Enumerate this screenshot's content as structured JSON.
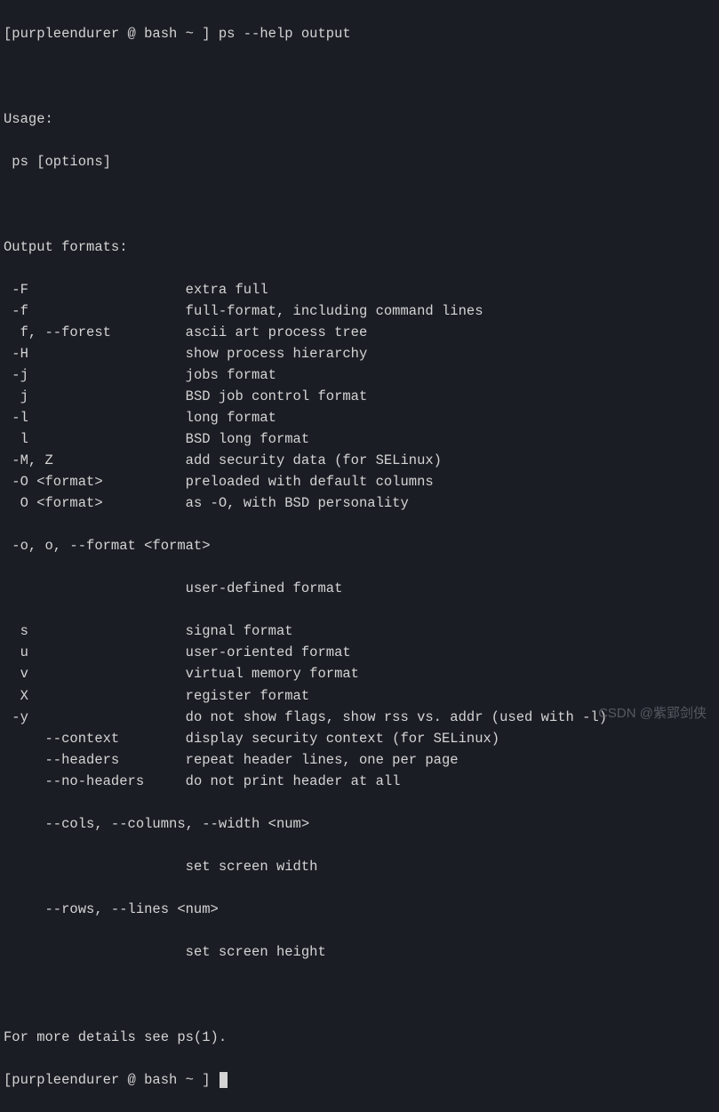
{
  "prompt1": {
    "user": "[purpleendurer @ bash ~ ] ",
    "command": "ps --help output"
  },
  "usage_header": "Usage:",
  "usage_line": " ps [options]",
  "section_header": "Output formats:",
  "options": [
    {
      "flag": " -F",
      "desc": "extra full"
    },
    {
      "flag": " -f",
      "desc": "full-format, including command lines"
    },
    {
      "flag": "  f, --forest",
      "desc": "ascii art process tree"
    },
    {
      "flag": " -H",
      "desc": "show process hierarchy"
    },
    {
      "flag": " -j",
      "desc": "jobs format"
    },
    {
      "flag": "  j",
      "desc": "BSD job control format"
    },
    {
      "flag": " -l",
      "desc": "long format"
    },
    {
      "flag": "  l",
      "desc": "BSD long format"
    },
    {
      "flag": " -M, Z",
      "desc": "add security data (for SELinux)"
    },
    {
      "flag": " -O <format>",
      "desc": "preloaded with default columns"
    },
    {
      "flag": "  O <format>",
      "desc": "as -O, with BSD personality"
    }
  ],
  "format_line": " -o, o, --format <format>",
  "format_desc": "user-defined format",
  "options2": [
    {
      "flag": "  s",
      "desc": "signal format"
    },
    {
      "flag": "  u",
      "desc": "user-oriented format"
    },
    {
      "flag": "  v",
      "desc": "virtual memory format"
    },
    {
      "flag": "  X",
      "desc": "register format"
    },
    {
      "flag": " -y",
      "desc": "do not show flags, show rss vs. addr (used with -l)"
    },
    {
      "flag": "     --context",
      "desc": "display security context (for SELinux)"
    },
    {
      "flag": "     --headers",
      "desc": "repeat header lines, one per page"
    },
    {
      "flag": "     --no-headers",
      "desc": "do not print header at all"
    }
  ],
  "cols_line": "     --cols, --columns, --width <num>",
  "cols_desc": "set screen width",
  "rows_line": "     --rows, --lines <num>",
  "rows_desc": "set screen height",
  "footer": "For more details see ps(1).",
  "prompt2": {
    "user": "[purpleendurer @ bash ~ ] "
  },
  "watermark": "CSDN @紫郢剑侠"
}
